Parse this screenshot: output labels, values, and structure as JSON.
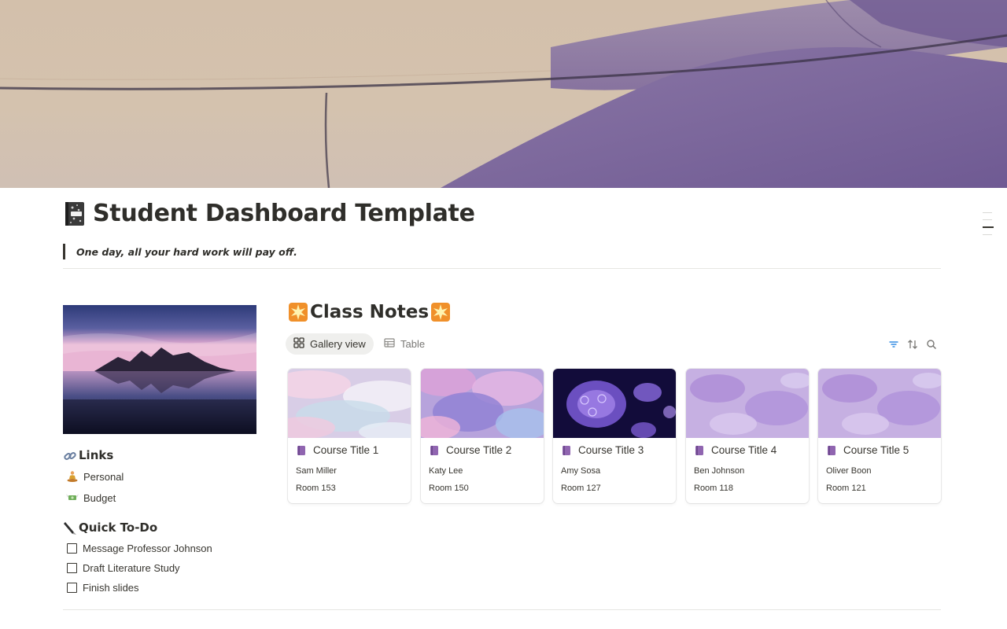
{
  "page": {
    "title": "Student Dashboard Template",
    "title_icon": "composition-notebook-icon",
    "quote": "One day, all your hard work will pay off."
  },
  "links": {
    "heading": "Links",
    "heading_icon": "link-icon",
    "items": [
      {
        "label": "Personal",
        "icon": "person-in-lotus-position-icon"
      },
      {
        "label": "Budget",
        "icon": "money-with-wings-icon"
      }
    ]
  },
  "todo": {
    "heading": "Quick To-Do",
    "heading_icon": "pen-icon",
    "items": [
      {
        "label": "Message Professor Johnson",
        "checked": false
      },
      {
        "label": "Draft Literature Study",
        "checked": false
      },
      {
        "label": "Finish slides",
        "checked": false
      }
    ]
  },
  "class_notes": {
    "title": "Class Notes",
    "title_icon": "eight-pointed-star-icon",
    "views": [
      {
        "label": "Gallery view",
        "icon": "grid-icon",
        "active": true
      },
      {
        "label": "Table",
        "icon": "table-icon",
        "active": false
      }
    ],
    "tools": [
      "filter-icon",
      "sort-icon",
      "search-icon"
    ],
    "cards": [
      {
        "title": "Course Title 1",
        "professor": "Sam Miller",
        "room": "Room 153",
        "cover": "pastel-clouds"
      },
      {
        "title": "Course Title 2",
        "professor": "Katy Lee",
        "room": "Room 150",
        "cover": "purple-pink-ink"
      },
      {
        "title": "Course Title 3",
        "professor": "Amy Sosa",
        "room": "Room 127",
        "cover": "jellyfish"
      },
      {
        "title": "Course Title 4",
        "professor": "Ben Johnson",
        "room": "Room 118",
        "cover": "lavender-watercolor"
      },
      {
        "title": "Course Title 5",
        "professor": "Oliver Boon",
        "room": "Room 121",
        "cover": "lavender-watercolor"
      }
    ]
  },
  "colors": {
    "accent_purple": "#9065b0",
    "text": "#37352f",
    "muted": "#787774",
    "cover_beige": "#d3c0ab",
    "cover_purple": "#7e6a9a"
  }
}
